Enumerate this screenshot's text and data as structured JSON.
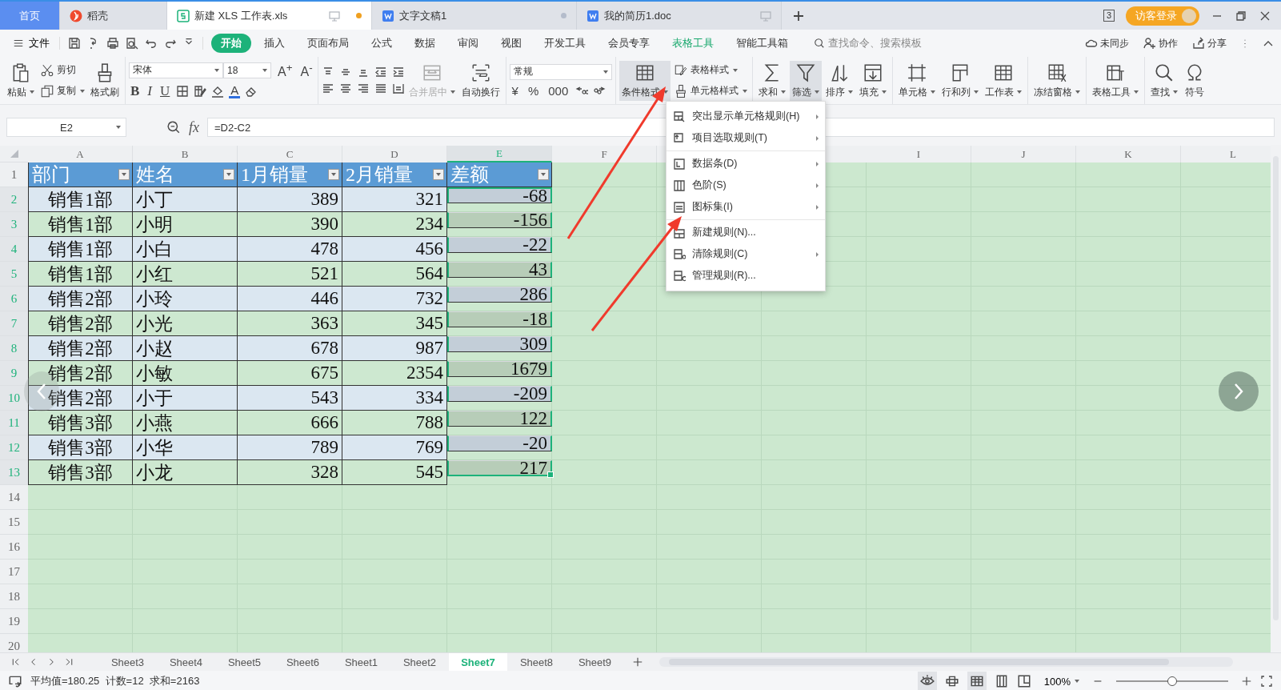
{
  "tabs": [
    {
      "label": "首页",
      "kind": "home",
      "selected": false
    },
    {
      "label": "稻壳",
      "kind": "docer",
      "selected": false
    },
    {
      "label": "新建 XLS 工作表.xls",
      "kind": "sheet",
      "selected": true,
      "monitor": true,
      "color": "#f0a020"
    },
    {
      "label": "文字文稿1",
      "kind": "writer",
      "selected": false,
      "monitor": false,
      "color": "#b4bccb"
    },
    {
      "label": "我的简历1.doc",
      "kind": "writer",
      "selected": false,
      "monitor": true
    }
  ],
  "window_count": "3",
  "login": "访客登录",
  "menu": {
    "file": "文件",
    "tabs": [
      {
        "label": "开始",
        "kind": "tab",
        "selected": true
      },
      {
        "label": "插入",
        "kind": "tab",
        "selected": false
      },
      {
        "label": "页面布局",
        "kind": "tab",
        "selected": false
      },
      {
        "label": "公式",
        "kind": "tab",
        "selected": false
      },
      {
        "label": "数据",
        "kind": "tab",
        "selected": false
      },
      {
        "label": "审阅",
        "kind": "tab",
        "selected": false
      },
      {
        "label": "视图",
        "kind": "tab",
        "selected": false
      },
      {
        "label": "开发工具",
        "kind": "tab",
        "selected": false
      },
      {
        "label": "会员专享",
        "kind": "tab",
        "selected": false
      },
      {
        "label": "表格工具",
        "kind": "context",
        "selected": false
      },
      {
        "label": "智能工具箱",
        "kind": "tab",
        "selected": false
      }
    ],
    "search": {
      "placeholder": "查找命令、搜索模板"
    },
    "actions": [
      "未同步",
      "协作",
      "分享"
    ]
  },
  "ribbon": [
    {
      "items": [
        {
          "kind": "large",
          "label": "粘贴",
          "dropdown": true
        },
        {
          "kind": "stack",
          "buttons": [
            {
              "label": "剪切",
              "dropdown": false
            },
            {
              "label": "复制",
              "dropdown": true
            }
          ]
        },
        {
          "kind": "large",
          "label": "格式刷",
          "dropdown": false
        }
      ]
    },
    {
      "items": [
        {
          "kind": "font",
          "font": "宋体",
          "size": "18",
          "grow": [
            "A$^{+}$",
            "A$^{-}$"
          ],
          "styles": [
            "B",
            "I",
            "U"
          ],
          "font_color": "A"
        }
      ]
    },
    {
      "items": [
        {
          "kind": "align"
        },
        {
          "kind": "large",
          "label": "合并居中",
          "dropdown": true,
          "disabled": true
        },
        {
          "kind": "large",
          "label": "自动换行",
          "dropdown": false
        }
      ]
    },
    {
      "items": [
        {
          "kind": "number",
          "format": "常规",
          "symbols": [
            "¥",
            "%",
            "000"
          ]
        }
      ]
    },
    {
      "items": [
        {
          "kind": "large",
          "label": "条件格式",
          "dropdown": true,
          "pressed": true
        },
        {
          "kind": "stack",
          "buttons": [
            {
              "label": "表格样式",
              "dropdown": true
            },
            {
              "label": "单元格样式",
              "dropdown": true
            }
          ]
        }
      ]
    },
    {
      "items": [
        {
          "kind": "large",
          "label": "求和",
          "dropdown": true
        },
        {
          "kind": "large",
          "label": "筛选",
          "dropdown": true,
          "pressed": true
        },
        {
          "kind": "large",
          "label": "排序",
          "dropdown": true
        },
        {
          "kind": "large",
          "label": "填充",
          "dropdown": true
        }
      ]
    },
    {
      "items": [
        {
          "kind": "large",
          "label": "单元格",
          "dropdown": true
        },
        {
          "kind": "large",
          "label": "行和列",
          "dropdown": true
        },
        {
          "kind": "large",
          "label": "工作表",
          "dropdown": true
        }
      ]
    },
    {
      "items": [
        {
          "kind": "large",
          "label": "冻结窗格",
          "dropdown": true
        }
      ]
    },
    {
      "items": [
        {
          "kind": "large",
          "label": "表格工具",
          "dropdown": true
        }
      ]
    },
    {
      "items": [
        {
          "kind": "large",
          "label": "查找",
          "dropdown": true
        },
        {
          "kind": "large",
          "label": "符号",
          "dropdown": false
        }
      ]
    }
  ],
  "formula_bar": {
    "cell_ref": "E2",
    "fx": "fx",
    "formula": "=D2-C2"
  },
  "columns": [
    {
      "label": "A",
      "selected": false
    },
    {
      "label": "B",
      "selected": false
    },
    {
      "label": "C",
      "selected": false
    },
    {
      "label": "D",
      "selected": false
    },
    {
      "label": "E",
      "selected": true
    },
    {
      "label": "F",
      "selected": false
    },
    {},
    {},
    {
      "label": "I",
      "selected": false
    },
    {
      "label": "J",
      "selected": false
    },
    {
      "label": "K",
      "selected": false
    },
    {
      "label": "L",
      "selected": false
    }
  ],
  "row_numbers": [
    {
      "label": "1",
      "selected": false
    },
    {
      "label": "2",
      "selected": true
    },
    {
      "label": "3",
      "selected": true
    },
    {
      "label": "4",
      "selected": true
    },
    {
      "label": "5",
      "selected": true
    },
    {
      "label": "6",
      "selected": true
    },
    {
      "label": "7",
      "selected": true
    },
    {
      "label": "8",
      "selected": true
    },
    {
      "label": "9",
      "selected": true
    },
    {
      "label": "10",
      "selected": true
    },
    {
      "label": "11",
      "selected": true
    },
    {
      "label": "12",
      "selected": true
    },
    {
      "label": "13",
      "selected": true
    },
    {
      "label": "14",
      "selected": false
    },
    {
      "label": "15",
      "selected": false
    },
    {
      "label": "16",
      "selected": false
    },
    {
      "label": "17",
      "selected": false
    },
    {
      "label": "18",
      "selected": false
    },
    {
      "label": "19",
      "selected": false
    },
    {
      "label": "20",
      "selected": false
    }
  ],
  "table": {
    "header": [
      "部门",
      "姓名",
      "1月销量",
      "2月销量",
      "差额"
    ],
    "rows": [
      [
        "销售1部",
        "小丁",
        "389",
        "321",
        "-68"
      ],
      [
        "销售1部",
        "小明",
        "390",
        "234",
        "-156"
      ],
      [
        "销售1部",
        "小白",
        "478",
        "456",
        "-22"
      ],
      [
        "销售1部",
        "小红",
        "521",
        "564",
        "43"
      ],
      [
        "销售2部",
        "小玲",
        "446",
        "732",
        "286"
      ],
      [
        "销售2部",
        "小光",
        "363",
        "345",
        "-18"
      ],
      [
        "销售2部",
        "小赵",
        "678",
        "987",
        "309"
      ],
      [
        "销售2部",
        "小敏",
        "675",
        "2354",
        "1679"
      ],
      [
        "销售2部",
        "小于",
        "543",
        "334",
        "-209"
      ],
      [
        "销售3部",
        "小燕",
        "666",
        "788",
        "122"
      ],
      [
        "销售3部",
        "小华",
        "789",
        "769",
        "-20"
      ],
      [
        "销售3部",
        "小龙",
        "328",
        "545",
        "217"
      ]
    ]
  },
  "context_menu": [
    {
      "items": [
        {
          "label": "突出显示单元格规则(H)",
          "submenu": true
        },
        {
          "label": "项目选取规则(T)",
          "submenu": true
        }
      ]
    },
    {
      "items": [
        {
          "label": "数据条(D)",
          "submenu": true
        },
        {
          "label": "色阶(S)",
          "submenu": true
        },
        {
          "label": "图标集(I)",
          "submenu": true
        }
      ]
    },
    {
      "items": [
        {
          "label": "新建规则(N)...",
          "submenu": false
        },
        {
          "label": "清除规则(C)",
          "submenu": true
        },
        {
          "label": "管理规则(R)...",
          "submenu": false
        }
      ]
    }
  ],
  "sheet_tabs": [
    {
      "label": "Sheet3",
      "selected": false
    },
    {
      "label": "Sheet4",
      "selected": false
    },
    {
      "label": "Sheet5",
      "selected": false
    },
    {
      "label": "Sheet6",
      "selected": false
    },
    {
      "label": "Sheet1",
      "selected": false
    },
    {
      "label": "Sheet2",
      "selected": false
    },
    {
      "label": "Sheet7",
      "selected": true
    },
    {
      "label": "Sheet8",
      "selected": false
    },
    {
      "label": "Sheet9",
      "selected": false
    }
  ],
  "status_bar": {
    "summary": "平均值=180.25  计数=12  求和=2163",
    "zoom": "100%",
    "zoom_slider": {
      "level": 0.5
    }
  }
}
